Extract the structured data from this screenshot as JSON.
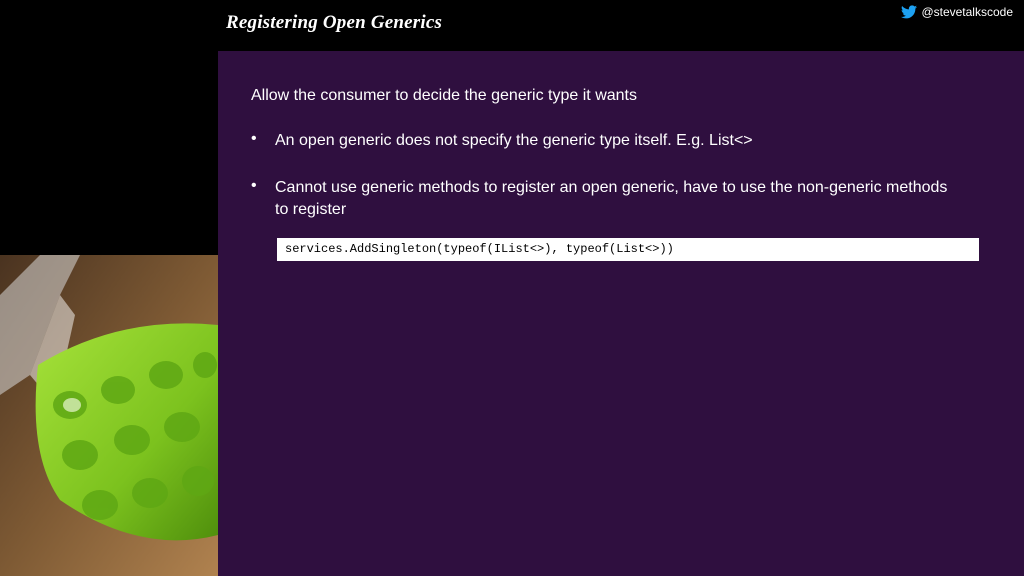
{
  "header": {
    "title": "Registering Open Generics",
    "handle": "@stevetalkscode",
    "handle_icon": "twitter-bird-icon"
  },
  "content": {
    "intro": "Allow the consumer to decide the generic type it wants",
    "bullets": [
      {
        "marker": "•",
        "text": "An open generic does not specify the generic type itself. E.g. List<>"
      },
      {
        "marker": "•",
        "text": "Cannot use generic methods to register an open generic, have to use the non-generic methods to register"
      }
    ],
    "code": "services.AddSingleton(typeof(IList<>), typeof(List<>))"
  },
  "colors": {
    "background": "#000000",
    "panel": "#2f0f3f",
    "text": "#ffffff",
    "twitter": "#1da1f2",
    "tray": "#8fd32a"
  }
}
